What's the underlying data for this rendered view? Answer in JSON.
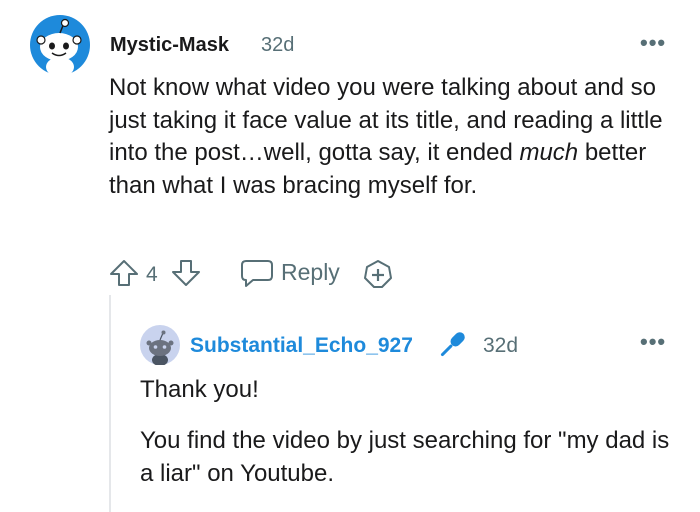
{
  "comment": {
    "author": "Mystic-Mask",
    "time": "32d",
    "more": "•••",
    "body_part1": "Not know what video you were talking about and so just taking it face value at its title, and reading a little into the post…well, gotta say, it ended ",
    "body_emphasis": "much",
    "body_part2": " better than what I was bracing myself for.",
    "vote_count": "4",
    "reply_label": "Reply"
  },
  "reply": {
    "author": "Substantial_Echo_927",
    "time": "32d",
    "more": "•••",
    "paragraph1": "Thank you!",
    "paragraph2": "You find the video by just searching for \"my dad is a liar\" on Youtube."
  },
  "colors": {
    "text": "#1a1a1b",
    "meta": "#576f76",
    "reply_author": "#1e8adb",
    "mic": "#1e8adb",
    "avatar_bg": "#1e8adb"
  },
  "icons": {
    "avatar_main": "snoo-avatar-icon",
    "avatar_reply": "snoo-avatar-icon",
    "upvote": "upvote-arrow-icon",
    "downvote": "downvote-arrow-icon",
    "reply": "speech-bubble-icon",
    "award": "plus-award-icon",
    "mic": "microphone-icon"
  }
}
